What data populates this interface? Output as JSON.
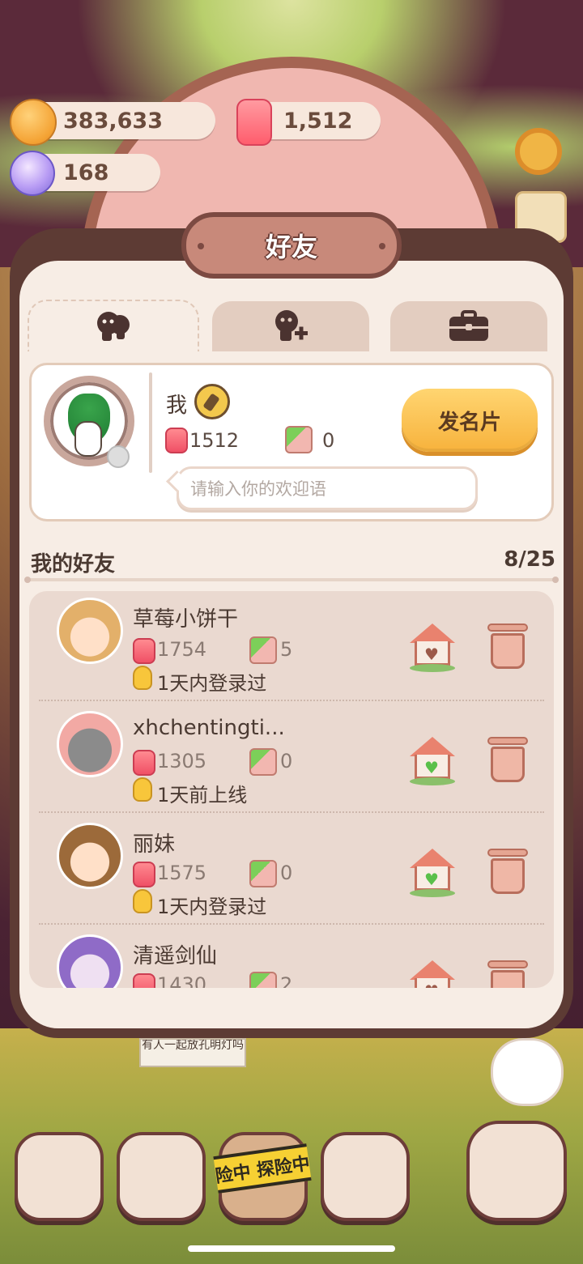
{
  "currencies": {
    "cookies": "383,633",
    "gems": "1,512",
    "candy": "168"
  },
  "panel": {
    "title": "好友",
    "tabs": [
      {
        "icon": "friends-icon",
        "active": true
      },
      {
        "icon": "add-friend-icon",
        "active": false
      },
      {
        "icon": "briefcase-icon",
        "active": false
      }
    ]
  },
  "my_card": {
    "name": "我",
    "candy_count": "1512",
    "likes": "0",
    "send_card_label": "发名片",
    "welcome_placeholder": "请输入你的欢迎语"
  },
  "friends_section": {
    "title": "我的好友",
    "count": "8/25"
  },
  "friends": [
    {
      "name": "草莓小饼干",
      "candy": "1754",
      "likes": "5",
      "status": "1天内登录过",
      "visited": false
    },
    {
      "name": "xhchentingti...",
      "candy": "1305",
      "likes": "0",
      "status": "1天前上线",
      "visited": true
    },
    {
      "name": "丽妹",
      "candy": "1575",
      "likes": "0",
      "status": "1天内登录过",
      "visited": true
    },
    {
      "name": "清遥剑仙",
      "candy": "1430",
      "likes": "2",
      "status": "",
      "visited": false
    }
  ],
  "bottom": {
    "sign_text": "有人一起放孔明灯吗",
    "explore_label": "险中 探险中"
  },
  "colors": {
    "panel_border": "#5d3b34",
    "panel_bg": "#f7ede5",
    "accent_button": "#f7b23c",
    "house_heart_green": "#5ac04a",
    "house_heart_brown": "#9c5a4a"
  }
}
